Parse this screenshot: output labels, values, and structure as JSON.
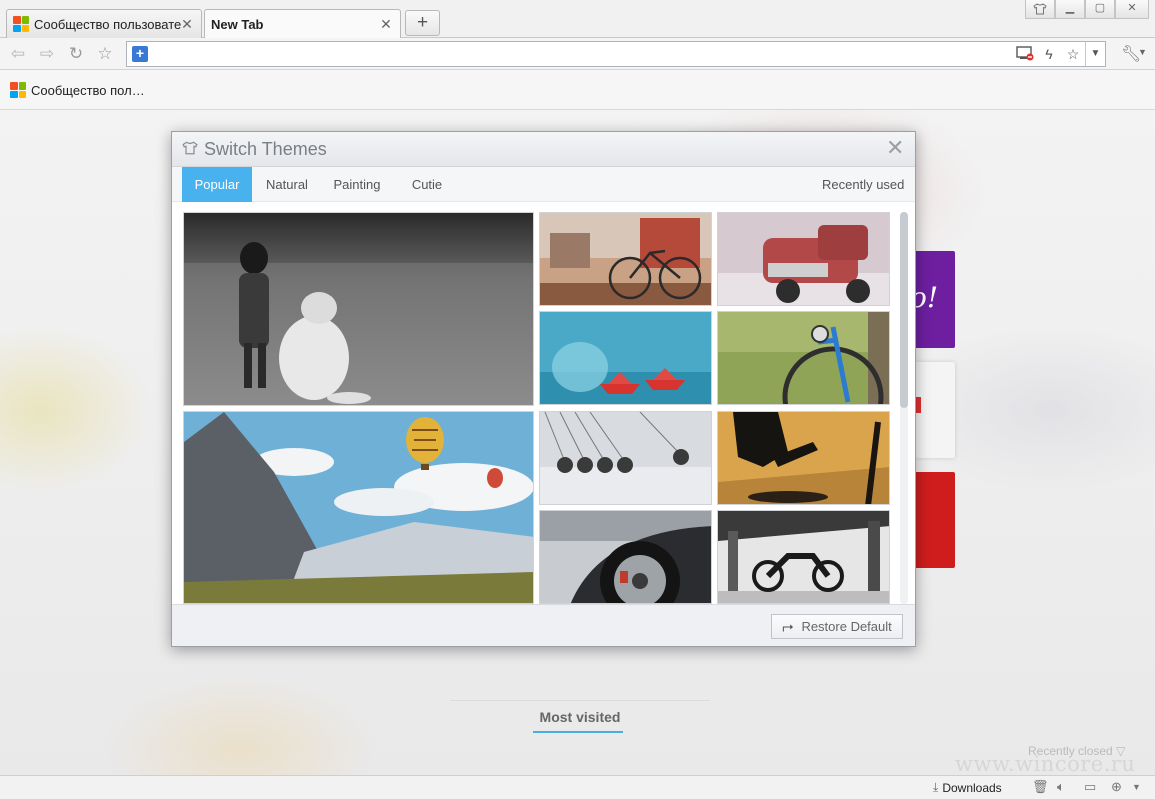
{
  "window": {
    "controls": [
      "skin",
      "minimize",
      "maximize",
      "close"
    ]
  },
  "tabs": [
    {
      "label": "Сообщество пользовате",
      "active": false,
      "favicon": "windows-logo-icon"
    },
    {
      "label": "New Tab",
      "active": true
    }
  ],
  "toolbar": {
    "back_icon": "back-arrow-icon",
    "forward_icon": "forward-arrow-icon",
    "reload_icon": "reload-icon",
    "bookmark_icon": "star-icon",
    "address_value": "",
    "address_icons": [
      "screen-record-icon",
      "lightning-icon",
      "star-icon"
    ]
  },
  "bookmarks": [
    {
      "label": "Сообщество пол…"
    }
  ],
  "dialog": {
    "title": "Switch Themes",
    "tabs": [
      {
        "label": "Popular",
        "active": true
      },
      {
        "label": "Natural",
        "active": false
      },
      {
        "label": "Painting",
        "active": false
      },
      {
        "label": "Cutie",
        "active": false
      }
    ],
    "recently_used": "Recently used",
    "restore_label": "Restore Default",
    "themes": [
      {
        "subject": "girl-with-dog-bw"
      },
      {
        "subject": "red-bicycle"
      },
      {
        "subject": "rusty-red-truck"
      },
      {
        "subject": "paper-boats-fishbowl"
      },
      {
        "subject": "blue-bicycle-wheel"
      },
      {
        "subject": "hot-air-balloons-mountains"
      },
      {
        "subject": "newtons-cradle"
      },
      {
        "subject": "skateboarder-silhouette"
      },
      {
        "subject": "car-wheel"
      },
      {
        "subject": "motorcycle-under-bridge"
      }
    ]
  },
  "page": {
    "most_visited": "Most visited",
    "recently_closed": "Recently closed",
    "tile_purple_text": "o!",
    "watermark": "www.wincore.ru"
  },
  "statusbar": {
    "downloads": "Downloads"
  },
  "colors": {
    "accent": "#48b2ef",
    "purple_tile": "#6d1fa0",
    "red_tile": "#cf1d1d"
  }
}
